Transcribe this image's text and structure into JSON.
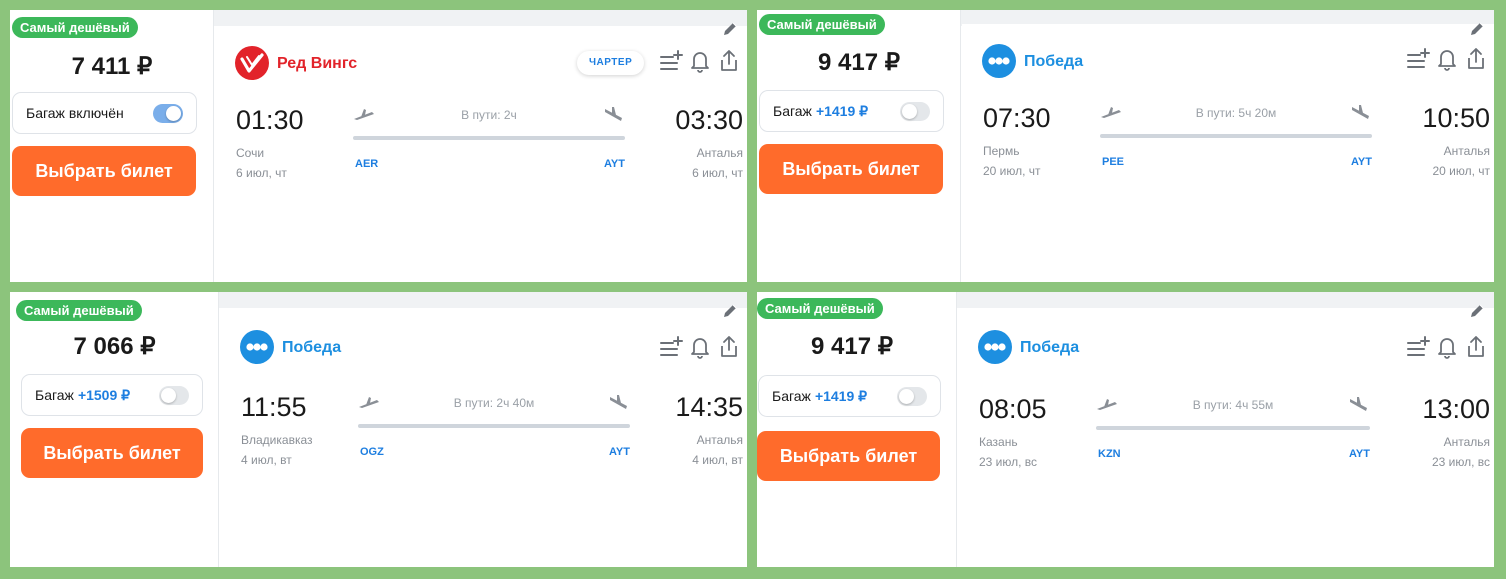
{
  "cards": [
    {
      "badge": "Самый дешёвый",
      "price": "7 411 ₽",
      "baggage": {
        "label": "Багаж включён",
        "extra": "",
        "checked": true
      },
      "buy_label": "Выбрать билет",
      "airline": {
        "name": "Ред Вингс",
        "logo": "red-wings-logo",
        "color": "#e2232a"
      },
      "charter": "ЧАРТЕР",
      "departure": {
        "time": "01:30",
        "city": "Сочи",
        "date": "6 июл, чт",
        "code": "AER"
      },
      "arrival": {
        "time": "03:30",
        "city": "Анталья",
        "date": "6 июл, чт",
        "code": "AYT"
      },
      "duration": "В пути: 2ч"
    },
    {
      "badge": "Самый дешёвый",
      "price": "9 417 ₽",
      "baggage": {
        "label": "Багаж",
        "extra": "+1419 ₽",
        "checked": false
      },
      "buy_label": "Выбрать билет",
      "airline": {
        "name": "Победа",
        "logo": "pobeda-logo",
        "color": "#1d8fe0"
      },
      "charter": "",
      "departure": {
        "time": "07:30",
        "city": "Пермь",
        "date": "20 июл, чт",
        "code": "PEE"
      },
      "arrival": {
        "time": "10:50",
        "city": "Анталья",
        "date": "20 июл, чт",
        "code": "AYT"
      },
      "duration": "В пути: 5ч 20м"
    },
    {
      "badge": "Самый дешёвый",
      "price": "7 066 ₽",
      "baggage": {
        "label": "Багаж",
        "extra": "+1509 ₽",
        "checked": false
      },
      "buy_label": "Выбрать билет",
      "airline": {
        "name": "Победа",
        "logo": "pobeda-logo",
        "color": "#1d8fe0"
      },
      "charter": "",
      "departure": {
        "time": "11:55",
        "city": "Владикавказ",
        "date": "4 июл, вт",
        "code": "OGZ"
      },
      "arrival": {
        "time": "14:35",
        "city": "Анталья",
        "date": "4 июл, вт",
        "code": "AYT"
      },
      "duration": "В пути: 2ч 40м"
    },
    {
      "badge": "Самый дешёвый",
      "price": "9 417 ₽",
      "baggage": {
        "label": "Багаж",
        "extra": "+1419 ₽",
        "checked": false
      },
      "buy_label": "Выбрать билет",
      "airline": {
        "name": "Победа",
        "logo": "pobeda-logo",
        "color": "#1d8fe0"
      },
      "charter": "",
      "departure": {
        "time": "08:05",
        "city": "Казань",
        "date": "23 июл, вс",
        "code": "KZN"
      },
      "arrival": {
        "time": "13:00",
        "city": "Анталья",
        "date": "23 июл, вс",
        "code": "AYT"
      },
      "duration": "В пути: 4ч 55м"
    }
  ],
  "icons": [
    "pencil-icon",
    "filter-add-icon",
    "bell-icon",
    "share-icon",
    "takeoff-icon",
    "landing-icon"
  ]
}
